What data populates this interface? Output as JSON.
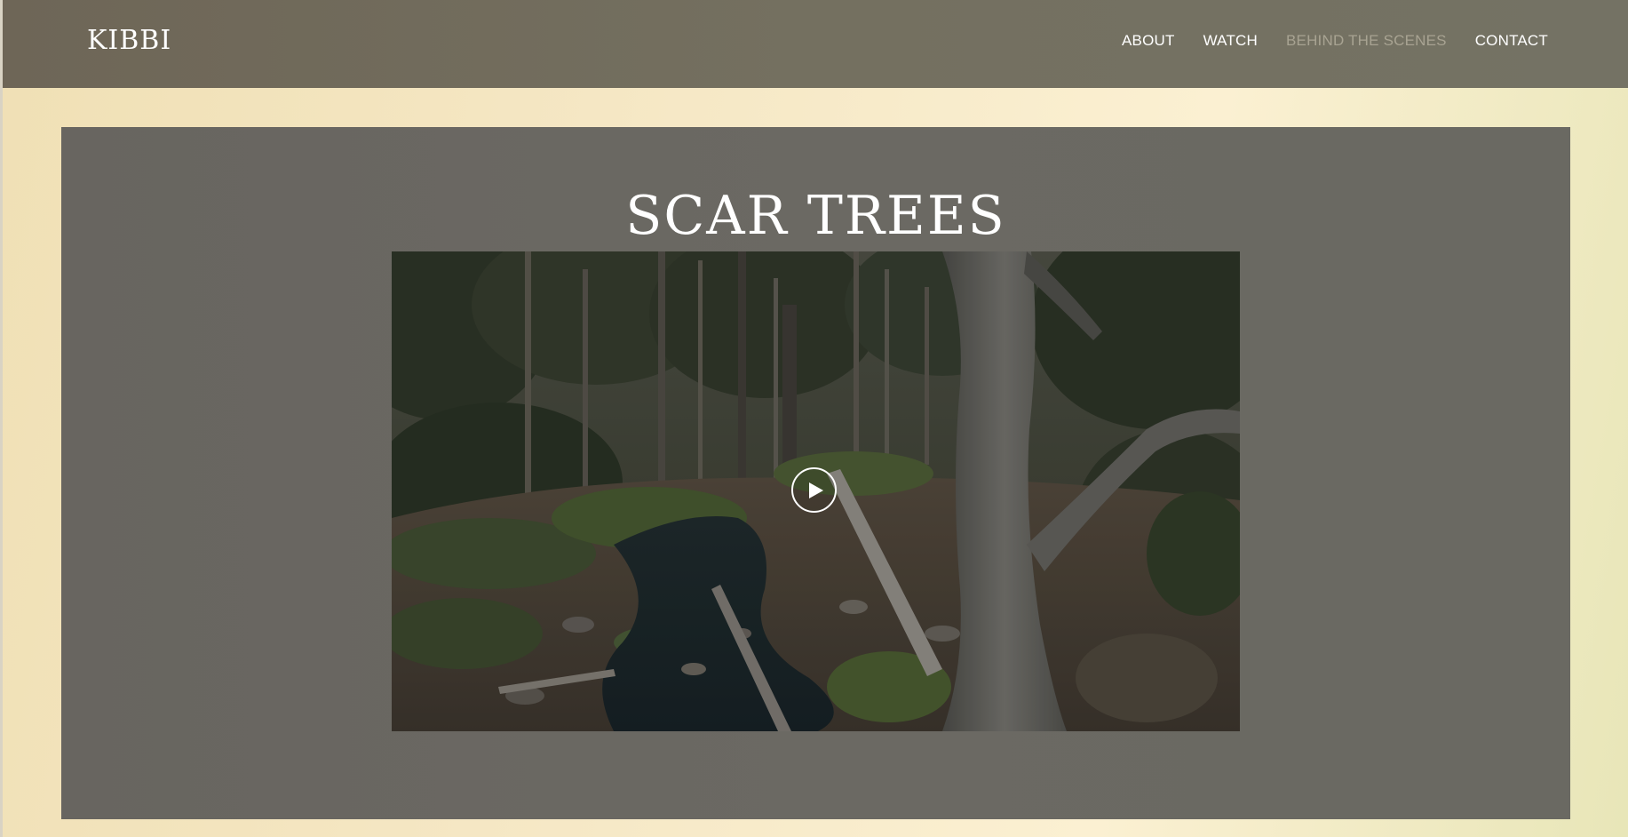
{
  "header": {
    "logo": "KIBBI",
    "nav": [
      {
        "label": "ABOUT",
        "active": false
      },
      {
        "label": "WATCH",
        "active": false
      },
      {
        "label": "BEHIND THE SCENES",
        "active": true
      },
      {
        "label": "CONTACT",
        "active": false
      }
    ]
  },
  "main": {
    "title": "SCAR TREES",
    "video": {
      "thumbnail": "bushland-creek-forest-scene",
      "play_icon": "play-icon"
    }
  },
  "colors": {
    "header_bg": "#736d5f",
    "panel_bg": "#696660",
    "page_bg": "#f5e7c4",
    "nav_active": "#a8a392",
    "text": "#ffffff"
  }
}
